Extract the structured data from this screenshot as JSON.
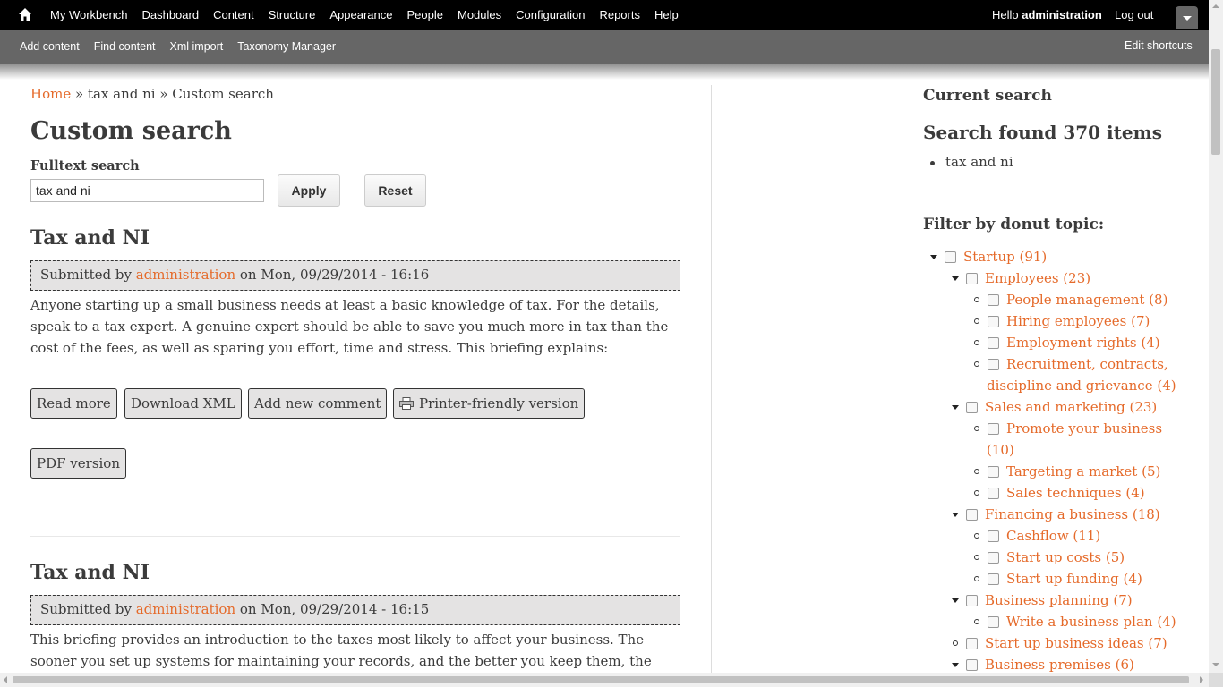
{
  "toolbar": {
    "menu": [
      "My Workbench",
      "Dashboard",
      "Content",
      "Structure",
      "Appearance",
      "People",
      "Modules",
      "Configuration",
      "Reports",
      "Help"
    ],
    "hello_prefix": "Hello",
    "user": "administration",
    "logout": "Log out"
  },
  "shortcuts": {
    "items": [
      "Add content",
      "Find content",
      "Xml import",
      "Taxonomy Manager"
    ],
    "edit": "Edit shortcuts"
  },
  "breadcrumb": {
    "home": "Home",
    "sep1": " » ",
    "middle": "tax and ni",
    "sep2": " » ",
    "current": "Custom search"
  },
  "page_title": "Custom search",
  "search": {
    "label": "Fulltext search",
    "value": "tax and ni",
    "apply": "Apply",
    "reset": "Reset"
  },
  "articles": [
    {
      "title": "Tax and NI",
      "submitted_by": "Submitted by",
      "author": "administration",
      "date": "on Mon, 09/29/2014 - 16:16",
      "body": "Anyone starting up a small business needs at least a basic knowledge of tax. For the details, speak to a tax expert. A genuine expert should be able to save you much more in tax than the cost of the fees, as well as sparing you effort, time and stress. This briefing explains:",
      "links": [
        "Read more",
        "Download XML",
        "Add new comment",
        "Printer-friendly version",
        "PDF version"
      ]
    },
    {
      "title": "Tax and NI",
      "submitted_by": "Submitted by",
      "author": "administration",
      "date": "on Mon, 09/29/2014 - 16:15",
      "body": "This briefing provides an introduction to the taxes most likely to affect your business. The sooner you set up systems for maintaining your records, and the better you keep them, the less money you"
    }
  ],
  "sidebar": {
    "current_search": "Current search",
    "found": "Search found 370 items",
    "active_term": "tax and ni",
    "filter_title": "Filter by donut topic:",
    "topics": [
      {
        "label": "Startup (91)",
        "level": 0,
        "expanded": true
      },
      {
        "label": "Employees (23)",
        "level": 1,
        "expanded": true
      },
      {
        "label": "People management (8)",
        "level": 2
      },
      {
        "label": "Hiring employees (7)",
        "level": 2
      },
      {
        "label": "Employment rights (4)",
        "level": 2
      },
      {
        "label": "Recruitment, contracts,",
        "label2": "discipline and grievance (4)",
        "level": 2
      },
      {
        "label": "Sales and marketing (23)",
        "level": 1,
        "expanded": true
      },
      {
        "label": "Promote your business",
        "label2": "(10)",
        "level": 2
      },
      {
        "label": "Targeting a market (5)",
        "level": 2
      },
      {
        "label": "Sales techniques (4)",
        "level": 2
      },
      {
        "label": "Financing a business (18)",
        "level": 1,
        "expanded": true
      },
      {
        "label": "Cashflow (11)",
        "level": 2
      },
      {
        "label": "Start up costs (5)",
        "level": 2
      },
      {
        "label": "Start up funding (4)",
        "level": 2
      },
      {
        "label": "Business planning (7)",
        "level": 1,
        "expanded": true
      },
      {
        "label": "Write a business plan (4)",
        "level": 2
      },
      {
        "label": "Start up business ideas (7)",
        "level": 1,
        "leaf": true
      },
      {
        "label": "Business premises (6)",
        "level": 1,
        "expanded": true
      }
    ]
  }
}
